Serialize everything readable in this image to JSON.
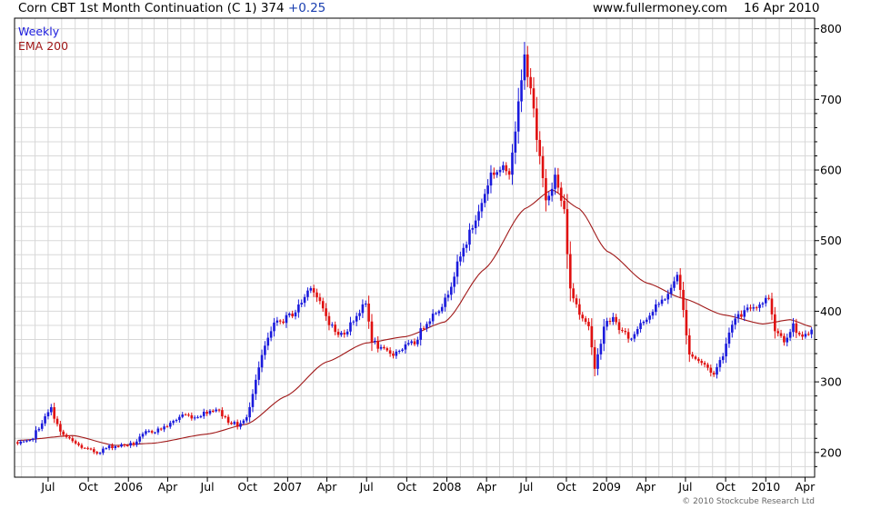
{
  "header": {
    "title": "Corn CBT 1st Month Continuation (C 1) 374",
    "change": "+0.25",
    "site": "www.fullermoney.com",
    "date": "16 Apr 2010"
  },
  "legend": {
    "primary": "Weekly",
    "overlay": "EMA 200"
  },
  "copyright": "© 2010 Stockcube Research Ltd",
  "colors": {
    "up": "#1a1adc",
    "down": "#e01010",
    "ema": "#a01818",
    "legend_primary": "#1a1adc",
    "legend_overlay": "#a01818",
    "grid": "#d8d8d8"
  },
  "chart_data": {
    "type": "candlestick",
    "frequency": "weekly",
    "ylim": [
      165,
      815
    ],
    "y_ticks": [
      200,
      300,
      400,
      500,
      600,
      700,
      800
    ],
    "y_tick_labels": [
      "200",
      "300",
      "400",
      "500",
      "600",
      "700",
      "800"
    ],
    "x_tick_labels": [
      "Jul",
      "Oct",
      "2006",
      "Apr",
      "Jul",
      "Oct",
      "2007",
      "Apr",
      "Jul",
      "Oct",
      "2008",
      "Apr",
      "Jul",
      "Oct",
      "2009",
      "Apr",
      "Jul",
      "Oct",
      "2010",
      "Apr"
    ],
    "x_tick_dates": [
      "2005-07-01",
      "2005-10-01",
      "2006-01-01",
      "2006-04-01",
      "2006-07-01",
      "2006-10-01",
      "2007-01-01",
      "2007-04-01",
      "2007-07-01",
      "2007-10-01",
      "2008-01-01",
      "2008-04-01",
      "2008-07-01",
      "2008-10-01",
      "2009-01-01",
      "2009-04-01",
      "2009-07-01",
      "2009-10-01",
      "2010-01-01",
      "2010-04-01"
    ],
    "x_range": [
      "2005-04-15",
      "2010-04-23"
    ],
    "close_anchors": [
      [
        "2005-04-22",
        212
      ],
      [
        "2005-05-20",
        215
      ],
      [
        "2005-06-17",
        243
      ],
      [
        "2005-07-08",
        262
      ],
      [
        "2005-07-29",
        228
      ],
      [
        "2005-08-26",
        215
      ],
      [
        "2005-09-23",
        205
      ],
      [
        "2005-10-21",
        200
      ],
      [
        "2005-11-18",
        208
      ],
      [
        "2005-12-16",
        210
      ],
      [
        "2006-01-13",
        212
      ],
      [
        "2006-02-10",
        228
      ],
      [
        "2006-03-10",
        232
      ],
      [
        "2006-04-07",
        240
      ],
      [
        "2006-05-05",
        254
      ],
      [
        "2006-06-02",
        250
      ],
      [
        "2006-06-30",
        258
      ],
      [
        "2006-07-21",
        262
      ],
      [
        "2006-08-18",
        245
      ],
      [
        "2006-09-08",
        238
      ],
      [
        "2006-09-29",
        248
      ],
      [
        "2006-10-20",
        305
      ],
      [
        "2006-11-10",
        350
      ],
      [
        "2006-12-01",
        380
      ],
      [
        "2006-12-29",
        390
      ],
      [
        "2007-01-19",
        400
      ],
      [
        "2007-02-09",
        420
      ],
      [
        "2007-02-23",
        438
      ],
      [
        "2007-03-16",
        410
      ],
      [
        "2007-04-06",
        385
      ],
      [
        "2007-04-27",
        365
      ],
      [
        "2007-05-18",
        375
      ],
      [
        "2007-06-08",
        395
      ],
      [
        "2007-06-29",
        410
      ],
      [
        "2007-07-13",
        360
      ],
      [
        "2007-08-03",
        345
      ],
      [
        "2007-08-31",
        340
      ],
      [
        "2007-09-28",
        350
      ],
      [
        "2007-10-19",
        355
      ],
      [
        "2007-11-09",
        380
      ],
      [
        "2007-12-07",
        400
      ],
      [
        "2007-12-28",
        415
      ],
      [
        "2008-01-25",
        465
      ],
      [
        "2008-02-22",
        510
      ],
      [
        "2008-03-14",
        540
      ],
      [
        "2008-04-11",
        595
      ],
      [
        "2008-05-02",
        600
      ],
      [
        "2008-05-23",
        600
      ],
      [
        "2008-06-13",
        690
      ],
      [
        "2008-06-27",
        760
      ],
      [
        "2008-07-11",
        720
      ],
      [
        "2008-07-25",
        640
      ],
      [
        "2008-08-15",
        560
      ],
      [
        "2008-09-05",
        590
      ],
      [
        "2008-09-26",
        540
      ],
      [
        "2008-10-10",
        430
      ],
      [
        "2008-10-31",
        400
      ],
      [
        "2008-11-21",
        380
      ],
      [
        "2008-12-05",
        315
      ],
      [
        "2008-12-26",
        380
      ],
      [
        "2009-01-16",
        390
      ],
      [
        "2009-02-06",
        370
      ],
      [
        "2009-02-27",
        360
      ],
      [
        "2009-03-20",
        385
      ],
      [
        "2009-04-10",
        395
      ],
      [
        "2009-05-01",
        410
      ],
      [
        "2009-05-29",
        430
      ],
      [
        "2009-06-12",
        455
      ],
      [
        "2009-06-26",
        400
      ],
      [
        "2009-07-10",
        340
      ],
      [
        "2009-07-31",
        330
      ],
      [
        "2009-08-21",
        320
      ],
      [
        "2009-09-04",
        310
      ],
      [
        "2009-09-25",
        340
      ],
      [
        "2009-10-16",
        385
      ],
      [
        "2009-11-06",
        395
      ],
      [
        "2009-11-27",
        405
      ],
      [
        "2009-12-18",
        410
      ],
      [
        "2010-01-08",
        420
      ],
      [
        "2010-01-22",
        375
      ],
      [
        "2010-02-12",
        360
      ],
      [
        "2010-03-05",
        380
      ],
      [
        "2010-03-26",
        360
      ],
      [
        "2010-04-16",
        374
      ]
    ],
    "ema_anchors": [
      [
        "2005-04-22",
        217
      ],
      [
        "2005-08-26",
        224
      ],
      [
        "2005-12-02",
        210
      ],
      [
        "2006-02-24",
        213
      ],
      [
        "2006-06-30",
        226
      ],
      [
        "2006-09-29",
        240
      ],
      [
        "2006-12-29",
        280
      ],
      [
        "2007-03-30",
        328
      ],
      [
        "2007-06-29",
        355
      ],
      [
        "2007-09-28",
        364
      ],
      [
        "2007-12-28",
        385
      ],
      [
        "2008-03-28",
        460
      ],
      [
        "2008-06-27",
        545
      ],
      [
        "2008-08-29",
        572
      ],
      [
        "2008-10-31",
        545
      ],
      [
        "2009-01-02",
        485
      ],
      [
        "2009-04-03",
        440
      ],
      [
        "2009-06-26",
        418
      ],
      [
        "2009-09-25",
        395
      ],
      [
        "2009-12-25",
        382
      ],
      [
        "2010-02-26",
        388
      ],
      [
        "2010-04-16",
        378
      ]
    ]
  }
}
